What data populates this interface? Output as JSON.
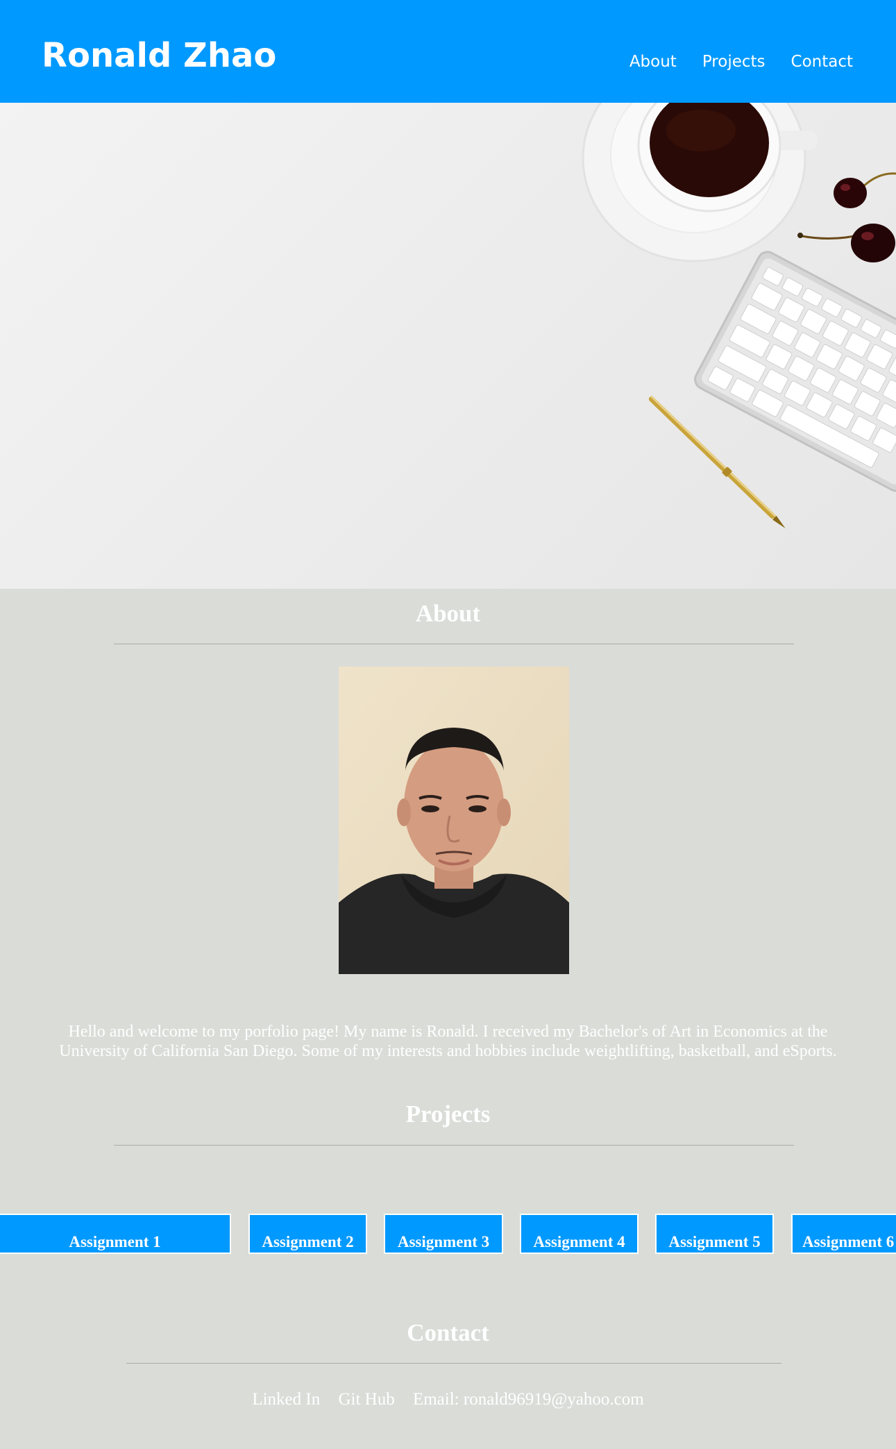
{
  "header": {
    "brand": "Ronald Zhao",
    "nav": [
      "About",
      "Projects",
      "Contact"
    ]
  },
  "hero": {
    "image": "desk-hero-image"
  },
  "about": {
    "title": "About",
    "text": "Hello and welcome to my porfolio page! My name is Ronald. I received my Bachelor's of Art in Economics at the University of California San Diego. Some of my interests and hobbies include weightlifting, basketball, and eSports."
  },
  "projects": {
    "title": "Projects",
    "items": [
      "Assignment 1",
      "Assignment 2",
      "Assignment 3",
      "Assignment 4",
      "Assignment 5",
      "Assignment 6"
    ]
  },
  "contact": {
    "title": "Contact",
    "links": [
      "Linked In",
      "Git Hub",
      "Email: ronald96919@yahoo.com"
    ]
  },
  "colors": {
    "header_bg": "#0099ff",
    "page_bg": "#dadcd8",
    "text": "#ffffff"
  }
}
